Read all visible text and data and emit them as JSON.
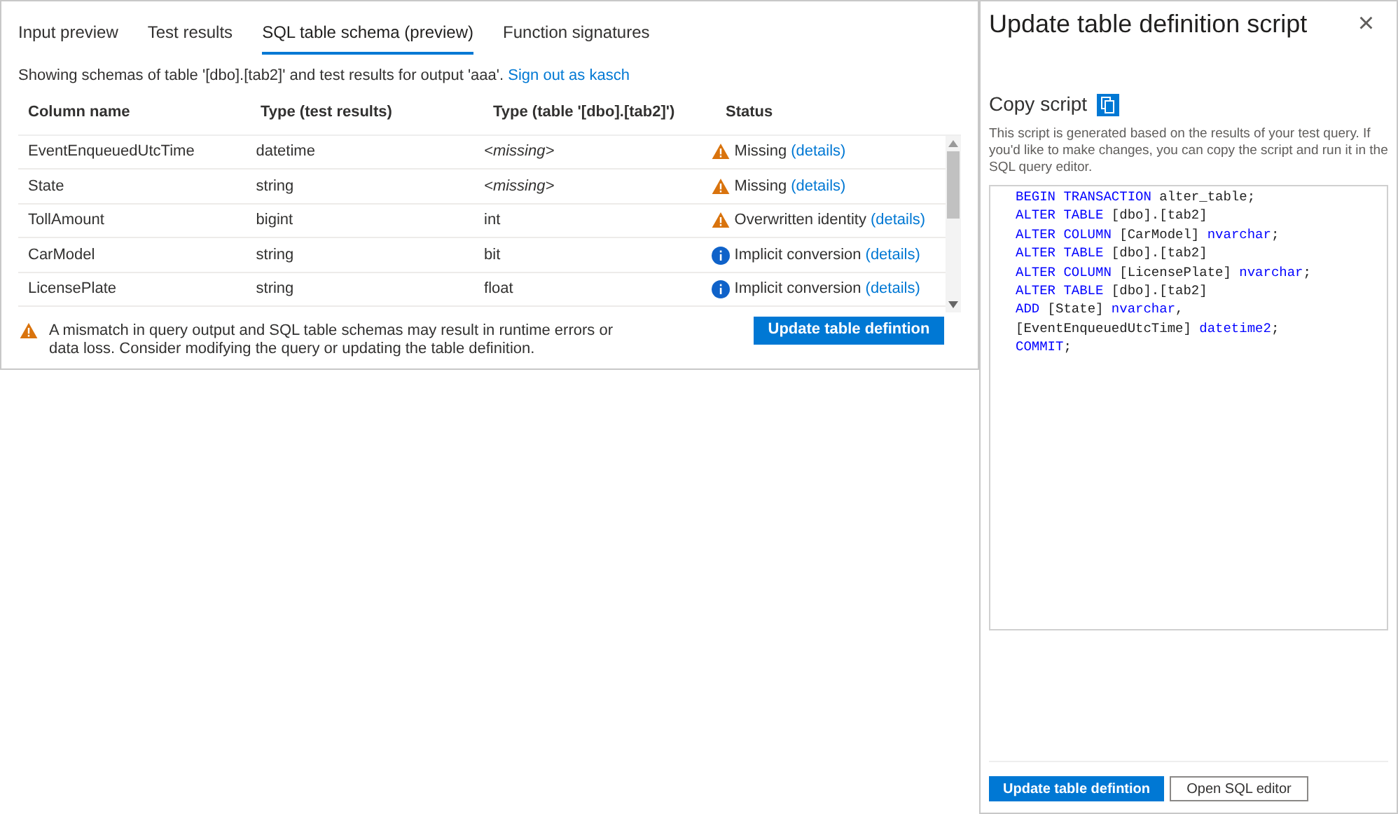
{
  "tabs": [
    {
      "label": "Input preview",
      "selected": false
    },
    {
      "label": "Test results",
      "selected": false
    },
    {
      "label": "SQL table schema (preview)",
      "selected": true
    },
    {
      "label": "Function signatures",
      "selected": false
    }
  ],
  "info": {
    "text": "Showing schemas of table '[dbo].[tab2]' and test results for output 'aaa'.",
    "link": "Sign out as kasch"
  },
  "table": {
    "columns": [
      "Column name",
      "Type (test results)",
      "Type (table '[dbo].[tab2]')",
      "Status"
    ],
    "rows": [
      {
        "name": "EventEnqueuedUtcTime",
        "test_type": "datetime",
        "table_type": "<missing>",
        "table_type_missing": true,
        "status": "Missing",
        "kind": "warning",
        "link": "(details)"
      },
      {
        "name": "State",
        "test_type": "string",
        "table_type": "<missing>",
        "table_type_missing": true,
        "status": "Missing",
        "kind": "warning",
        "link": "(details)"
      },
      {
        "name": "TollAmount",
        "test_type": "bigint",
        "table_type": "int",
        "table_type_missing": false,
        "status": "Overwritten identity",
        "kind": "warning",
        "link": "(details)"
      },
      {
        "name": "CarModel",
        "test_type": "string",
        "table_type": "bit",
        "table_type_missing": false,
        "status": "Implicit conversion",
        "kind": "info",
        "link": "(details)"
      },
      {
        "name": "LicensePlate",
        "test_type": "string",
        "table_type": "float",
        "table_type_missing": false,
        "status": "Implicit conversion",
        "kind": "info",
        "link": "(details)"
      }
    ]
  },
  "warning": "A mismatch in query output and SQL table schemas may result in runtime errors or data loss. Consider modifying the query or updating the table definition.",
  "update_button": "Update table defintion",
  "panel": {
    "title": "Update table definition script",
    "close": "×",
    "copy_label": "Copy script",
    "description": "This script is generated based on the results of your test query. If you'd like to make changes, you can copy the script and run it in the SQL query editor.",
    "script": [
      [
        {
          "kind": "keyword",
          "text": "BEGIN TRANSACTION"
        },
        {
          "kind": "plain",
          "text": " alter_table;"
        }
      ],
      [
        {
          "kind": "keyword",
          "text": "ALTER TABLE"
        },
        {
          "kind": "plain",
          "text": " [dbo].[tab2]"
        }
      ],
      [
        {
          "kind": "keyword",
          "text": "ALTER COLUMN"
        },
        {
          "kind": "plain",
          "text": " [CarModel] "
        },
        {
          "kind": "keyword",
          "text": "nvarchar"
        },
        {
          "kind": "plain",
          "text": ";"
        }
      ],
      [
        {
          "kind": "keyword",
          "text": "ALTER TABLE"
        },
        {
          "kind": "plain",
          "text": " [dbo].[tab2]"
        }
      ],
      [
        {
          "kind": "keyword",
          "text": "ALTER COLUMN"
        },
        {
          "kind": "plain",
          "text": " [LicensePlate] "
        },
        {
          "kind": "keyword",
          "text": "nvarchar"
        },
        {
          "kind": "plain",
          "text": ";"
        }
      ],
      [
        {
          "kind": "keyword",
          "text": "ALTER TABLE"
        },
        {
          "kind": "plain",
          "text": " [dbo].[tab2]"
        }
      ],
      [
        {
          "kind": "keyword",
          "text": "ADD"
        },
        {
          "kind": "plain",
          "text": " [State] "
        },
        {
          "kind": "keyword",
          "text": "nvarchar"
        },
        {
          "kind": "plain",
          "text": ","
        }
      ],
      [
        {
          "kind": "plain",
          "text": "[EventEnqueuedUtcTime] "
        },
        {
          "kind": "keyword",
          "text": "datetime2"
        },
        {
          "kind": "plain",
          "text": ";"
        }
      ],
      [
        {
          "kind": "keyword",
          "text": "COMMIT"
        },
        {
          "kind": "plain",
          "text": ";"
        }
      ]
    ],
    "primary_button": "Update table defintion",
    "secondary_button": "Open SQL editor"
  }
}
